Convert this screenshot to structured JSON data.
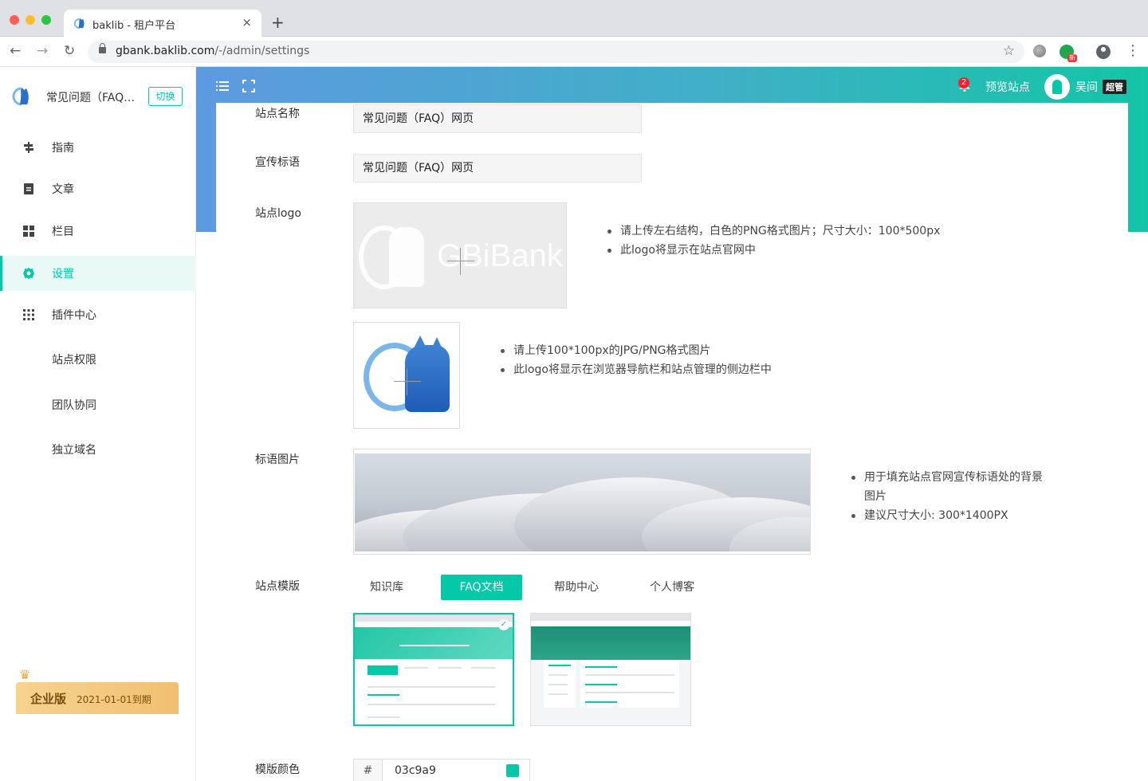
{
  "browser": {
    "tab_title": "baklib - 租户平台",
    "tab_close": "×",
    "new_tab": "+",
    "url_host": "gbank.baklib.com",
    "url_path": "/-/admin/settings",
    "back": "←",
    "forward": "→",
    "reload": "↻",
    "star": "☆",
    "menu": "⋮",
    "ext_badge": "新"
  },
  "sidebar": {
    "site_name": "常见问题（FAQ）网页",
    "switch_label": "切换",
    "menu": [
      {
        "label": "指南",
        "icon": "signpost-icon"
      },
      {
        "label": "文章",
        "icon": "document-icon"
      },
      {
        "label": "栏目",
        "icon": "grid-icon"
      },
      {
        "label": "设置",
        "icon": "gear-icon",
        "active": true
      },
      {
        "label": "插件中心",
        "icon": "apps-icon"
      }
    ],
    "sub_items": [
      "站点权限",
      "团队协同",
      "独立域名"
    ],
    "plan": {
      "name": "企业版",
      "expiry": "2021-01-01到期"
    }
  },
  "header": {
    "notification_count": "2",
    "preview_label": "预览站点",
    "user_name": "吴间",
    "user_role": "超管"
  },
  "form": {
    "site_name_label": "站点名称",
    "site_name_value": "常见问题（FAQ）网页",
    "slogan_label": "宣传标语",
    "slogan_value": "常见问题（FAQ）网页",
    "logo_label": "站点logo",
    "logo_ghost_text": "GBiBank",
    "logo_hints": [
      "请上传左右结构，白色的PNG格式图片；尺寸大小：100*500px",
      "此logo将显示在站点官网中"
    ],
    "icon_hints": [
      "请上传100*100px的JPG/PNG格式图片",
      "此logo将显示在浏览器导航栏和站点管理的侧边栏中"
    ],
    "banner_label": "标语图片",
    "banner_hints": [
      "用于填充站点官网宣传标语处的背景图片",
      "建议尺寸大小: 300*1400PX"
    ],
    "template_label": "站点模版",
    "template_tabs": [
      "知识库",
      "FAQ文档",
      "帮助中心",
      "个人博客"
    ],
    "template_active": "FAQ文档",
    "color_label": "模版颜色",
    "color_hash": "#",
    "color_value": "03c9a9"
  },
  "colors": {
    "accent": "#03c9a9",
    "header_start": "#5d9ae0",
    "header_end": "#13c5a6"
  }
}
